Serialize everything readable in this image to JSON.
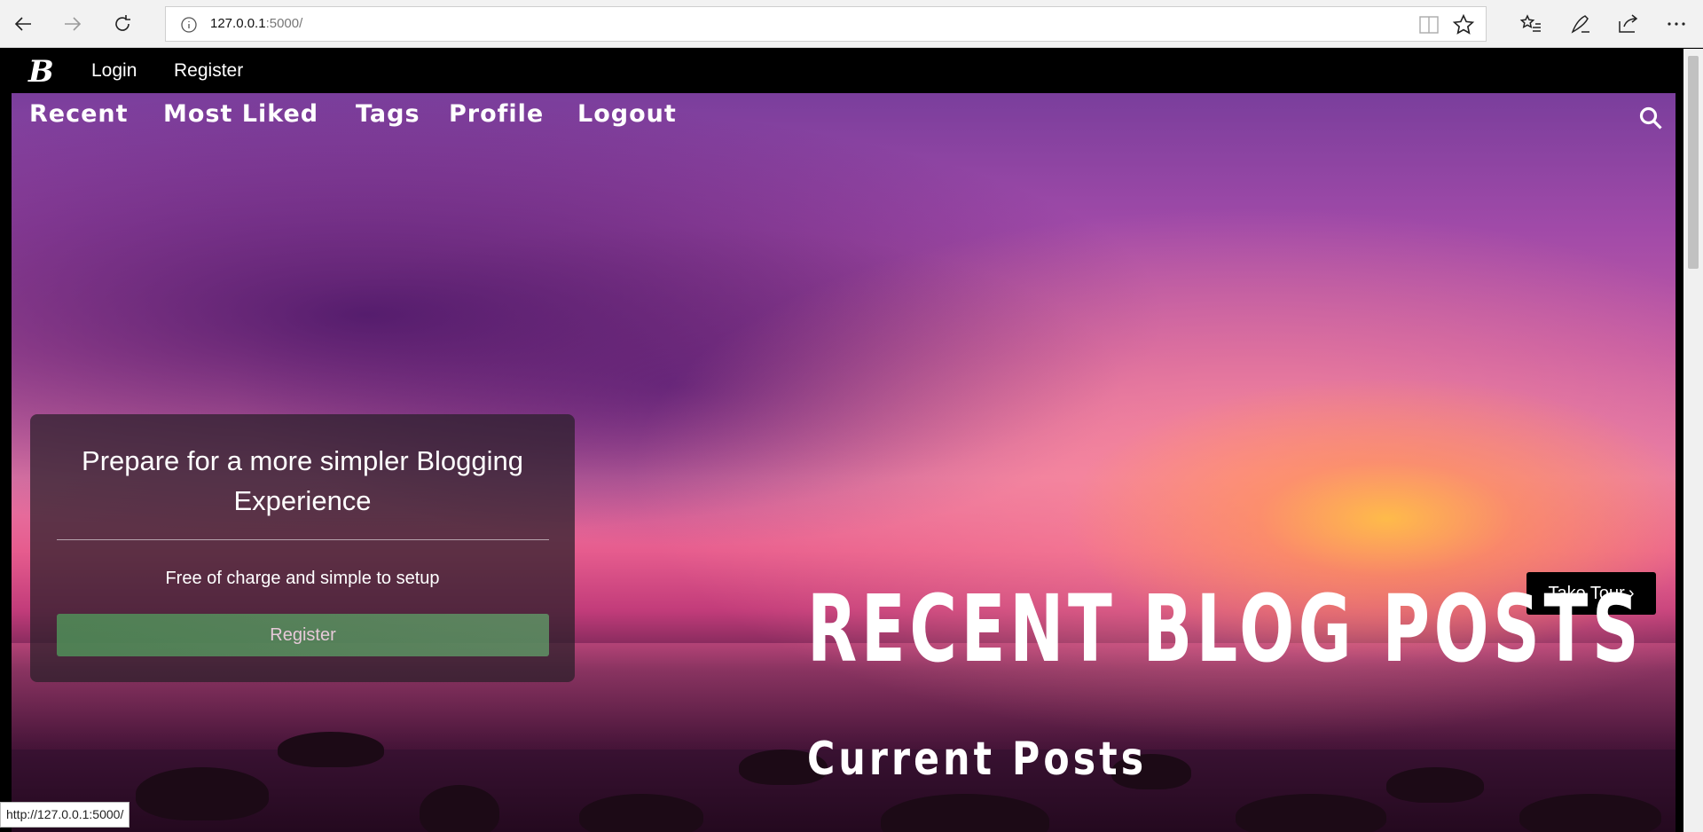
{
  "browser": {
    "url_host": "127.0.0.1",
    "url_rest": ":5000/"
  },
  "site": {
    "logo": "B",
    "top_links": [
      "Login",
      "Register"
    ]
  },
  "menu": {
    "items": [
      "Recent",
      "Most Liked",
      "Tags",
      "Profile",
      "Logout"
    ]
  },
  "card": {
    "title": "Prepare for a more simpler Blogging Experience",
    "subtitle": "Free of charge and simple to setup",
    "button": "Register"
  },
  "tour_button": "Take Tour",
  "tour_chevron": "›",
  "headline": "RECENT BLOG POSTS",
  "subheadline": "Current Posts",
  "status_url": "http://127.0.0.1:5000/"
}
